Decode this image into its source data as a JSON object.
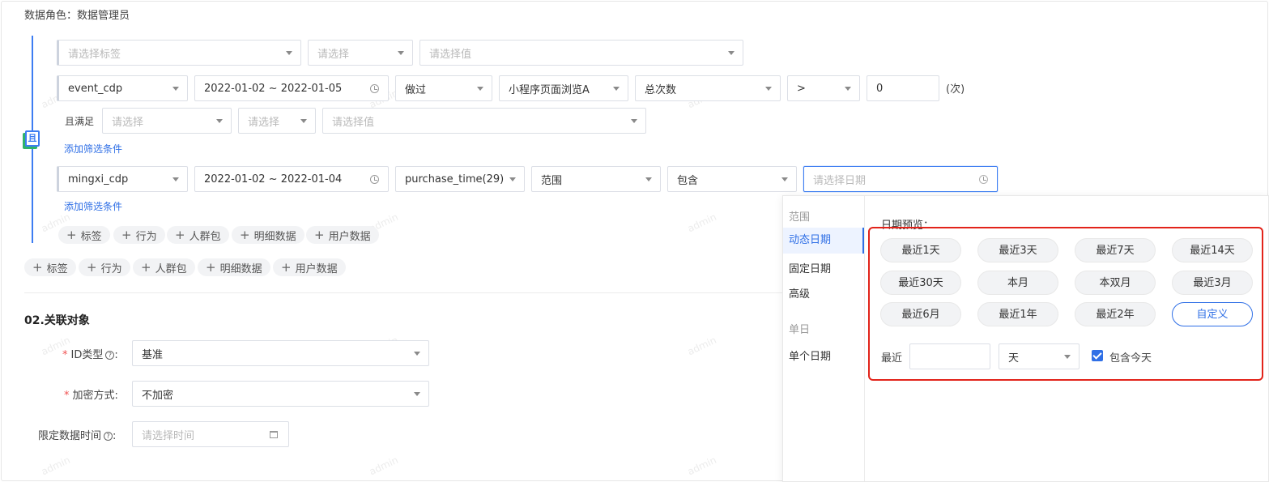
{
  "header": {
    "role_label": "数据角色：",
    "role_value": "数据管理员"
  },
  "group_badge": "且",
  "rows": {
    "row1": {
      "tag_placeholder": "请选择标签",
      "op_placeholder": "请选择",
      "value_placeholder": "请选择值"
    },
    "row2": {
      "event": "event_cdp",
      "date_range": "2022-01-02 ~ 2022-01-05",
      "action": "做过",
      "event_name": "小程序页面浏览A",
      "metric": "总次数",
      "comparator": ">",
      "count": "0",
      "unit": "(次)"
    },
    "row3": {
      "label": "且满足",
      "field_placeholder": "请选择",
      "op_placeholder": "请选择",
      "value_placeholder": "请选择值"
    },
    "add_filter_1": "添加筛选条件",
    "row4": {
      "table": "mingxi_cdp",
      "date_range": "2022-01-02 ~ 2022-01-04",
      "field": "purchase_time(29)",
      "operator": "范围",
      "match": "包含",
      "date_placeholder": "请选择日期"
    },
    "add_filter_2": "添加筛选条件"
  },
  "chips": [
    "标签",
    "行为",
    "人群包",
    "明细数据",
    "用户数据"
  ],
  "section2": {
    "title": "02.关联对象",
    "id_type_label": "ID类型",
    "id_type_value": "基准",
    "encrypt_label": "加密方式",
    "encrypt_value": "不加密",
    "time_label": "限定数据时间",
    "time_placeholder": "请选择时间",
    "help_glyph": "?",
    "colon": ":",
    "required_mark": "*"
  },
  "popup": {
    "group_range": "范围",
    "items_range": [
      "动态日期",
      "固定日期",
      "高级"
    ],
    "group_single": "单日",
    "items_single": [
      "单个日期"
    ],
    "preview_label": "日期预览：",
    "quick_buttons": [
      "最近1天",
      "最近3天",
      "最近7天",
      "最近14天",
      "最近30天",
      "本月",
      "本双月",
      "最近3月",
      "最近6月",
      "最近1年",
      "最近2年",
      "自定义"
    ],
    "recent_label": "最近",
    "recent_value": "",
    "unit_value": "天",
    "include_today_label": "包含今天",
    "include_today_checked": true
  },
  "watermark": "admin",
  "colors": {
    "primary": "#2f6fe6",
    "highlight_border": "#e2231a",
    "group_line": "#3d7df2"
  }
}
